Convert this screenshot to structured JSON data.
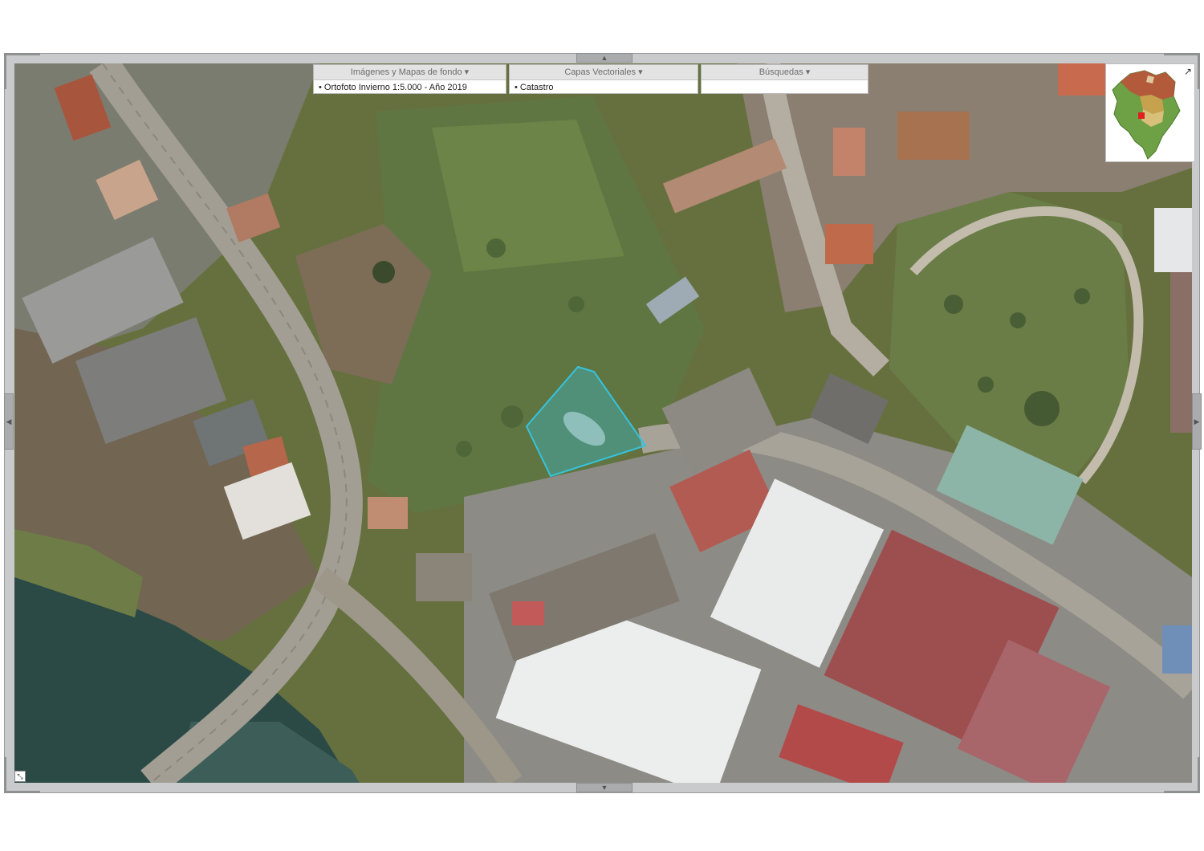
{
  "menus": [
    {
      "title": "Imágenes y Mapas de fondo ▾",
      "value": "• Ortofoto Invierno 1:5.000 - Año 2019"
    },
    {
      "title": "Capas Vectoriales ▾",
      "value": "• Catastro"
    },
    {
      "title": "Búsquedas ▾",
      "value": ""
    }
  ],
  "controls": {
    "pan_up": "▲",
    "pan_down": "▼",
    "pan_left": "◀",
    "pan_right": "▶",
    "overview_expand": "↗",
    "fullscreen": "⤡"
  },
  "highlight_color": "#36c3dc"
}
